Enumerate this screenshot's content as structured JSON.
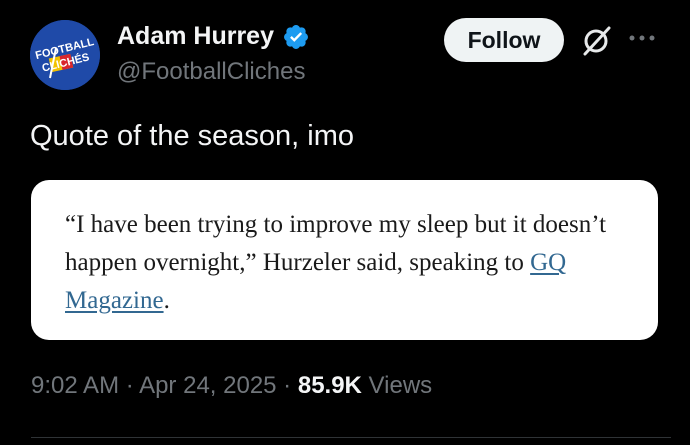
{
  "author": {
    "display_name": "Adam Hurrey",
    "handle": "@FootballCliches",
    "verified": true,
    "avatar_text_line1": "FOOTBALL",
    "avatar_text_line2": "CLICHÉS"
  },
  "actions": {
    "follow_label": "Follow",
    "grok_icon": "grok-icon",
    "more_icon": "more-icon"
  },
  "tweet": {
    "text": "Quote of the season, imo"
  },
  "quote_card": {
    "text_before_link": "“I have been trying to improve my sleep but it doesn’t happen overnight,” Hurzeler said, speaking to ",
    "link_text": "GQ Magazine",
    "text_after_link": "."
  },
  "meta": {
    "time": "9:02 AM",
    "separator1": " · ",
    "date": "Apr 24, 2025",
    "separator2": " · ",
    "views_count": "85.9K",
    "views_label": " Views"
  },
  "colors": {
    "background": "#000000",
    "accent_verified": "#1d9bf0",
    "link": "#326891",
    "follow_button_bg": "#eff3f4"
  }
}
